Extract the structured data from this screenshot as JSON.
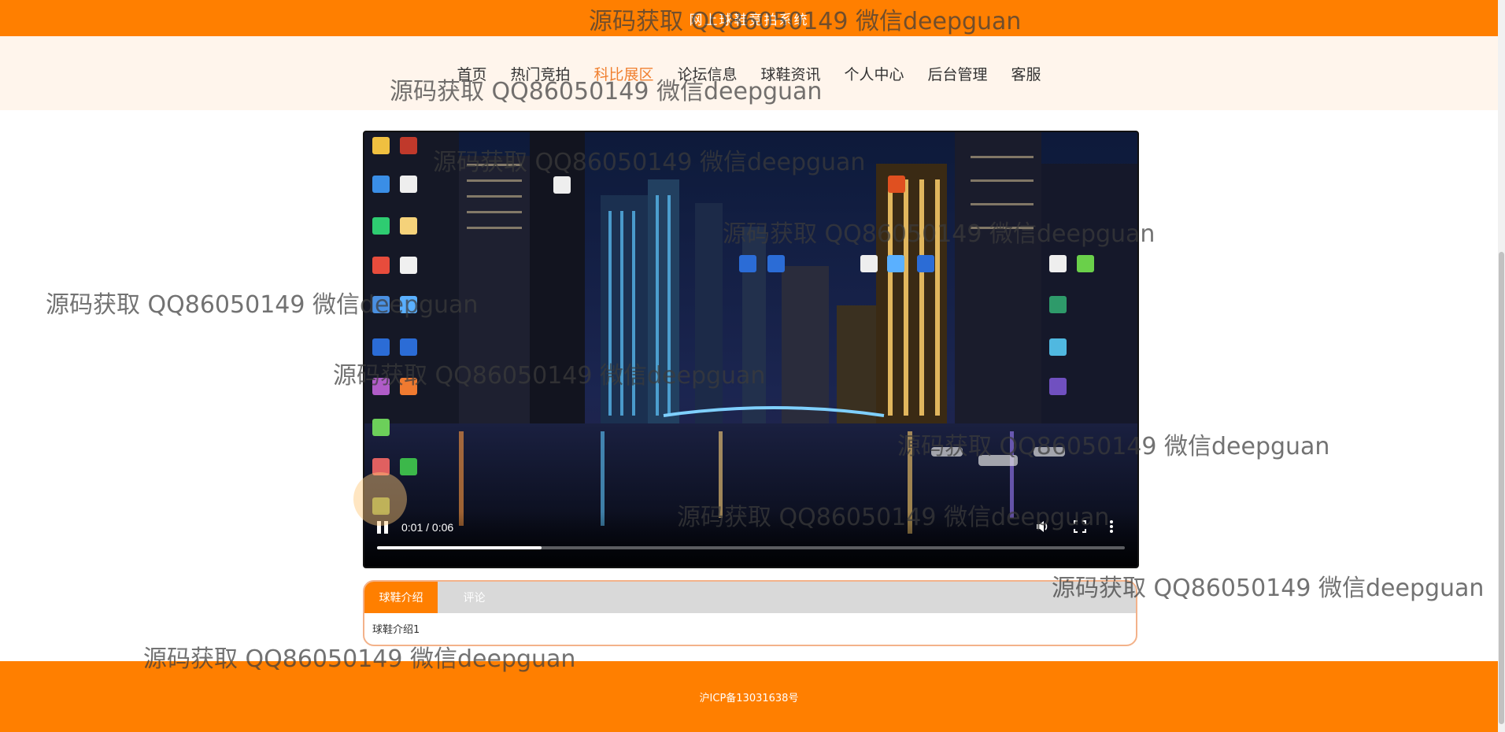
{
  "header": {
    "title": "网上球鞋竞拍系统"
  },
  "nav": {
    "items": [
      {
        "label": "首页"
      },
      {
        "label": "热门竞拍"
      },
      {
        "label": "科比展区"
      },
      {
        "label": "论坛信息"
      },
      {
        "label": "球鞋资讯"
      },
      {
        "label": "个人中心"
      },
      {
        "label": "后台管理"
      },
      {
        "label": "客服"
      }
    ],
    "active_index": 2,
    "active_color": "#f08030"
  },
  "video": {
    "time": "0:01 / 0:06",
    "progress": 0.22,
    "state": "playing"
  },
  "tabs": {
    "items": [
      {
        "label": "球鞋介绍"
      },
      {
        "label": "评论"
      }
    ],
    "active_index": 0,
    "content": "球鞋介绍1"
  },
  "footer": {
    "icp": "沪ICP备13031638号"
  },
  "watermark": {
    "text": "源码获取 QQ86050149 微信deepguan"
  },
  "colors": {
    "brand": "#ff7f00",
    "nav_bg": "#fff5ec",
    "tab_border": "#f3b28a"
  },
  "icons": [
    "pause-icon",
    "volume-icon",
    "fullscreen-icon",
    "more-vert-icon"
  ]
}
